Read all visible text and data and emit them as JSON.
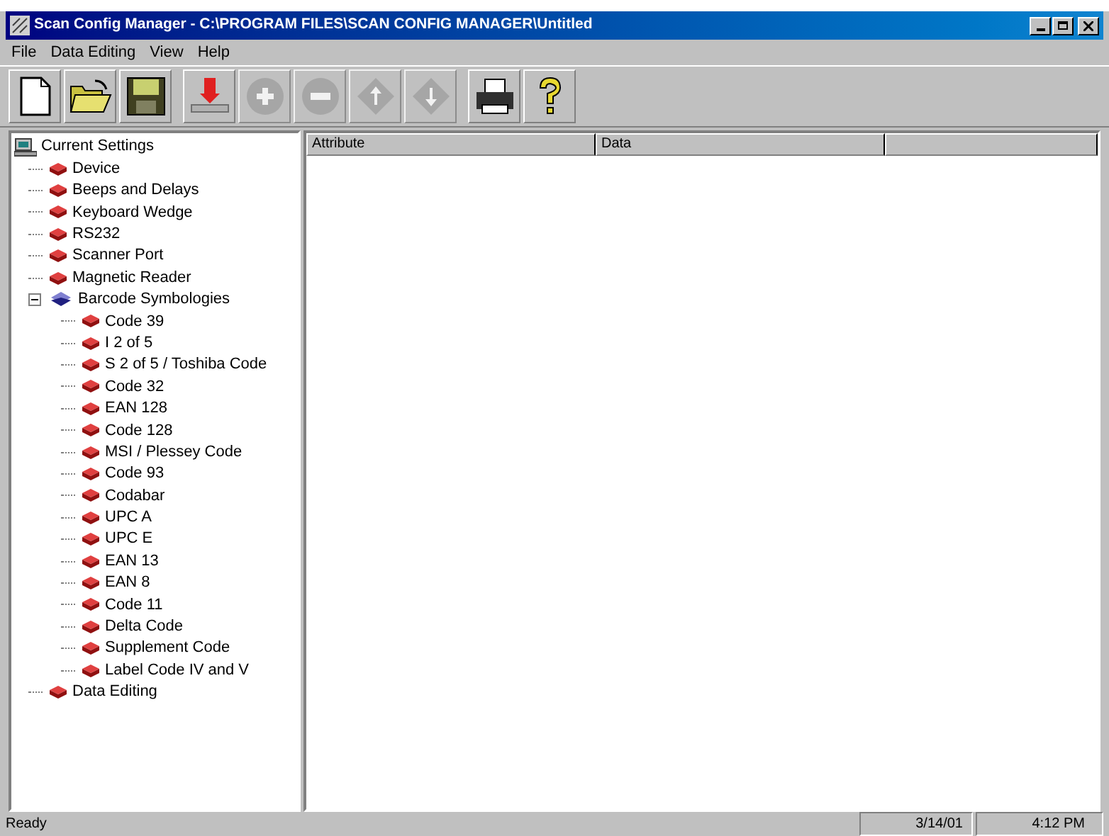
{
  "window": {
    "title": "Scan Config Manager - C:\\PROGRAM FILES\\SCAN CONFIG MANAGER\\Untitled"
  },
  "menu": [
    "File",
    "Data Editing",
    "View",
    "Help"
  ],
  "toolbar": [
    {
      "kind": "new",
      "disabled": false
    },
    {
      "kind": "open",
      "disabled": false
    },
    {
      "kind": "save",
      "disabled": false
    },
    {
      "kind": "download",
      "disabled": false
    },
    {
      "kind": "add",
      "disabled": true
    },
    {
      "kind": "remove",
      "disabled": true
    },
    {
      "kind": "up",
      "disabled": true
    },
    {
      "kind": "down",
      "disabled": true
    },
    {
      "kind": "print",
      "disabled": false
    },
    {
      "kind": "help",
      "disabled": false
    }
  ],
  "tree": {
    "label": "Current Settings",
    "children": [
      {
        "label": "Device"
      },
      {
        "label": "Beeps and Delays"
      },
      {
        "label": "Keyboard Wedge"
      },
      {
        "label": "RS232"
      },
      {
        "label": "Scanner Port"
      },
      {
        "label": "Magnetic Reader"
      },
      {
        "label": "Barcode Symbologies",
        "expanded": true,
        "children": [
          {
            "label": "Code 39"
          },
          {
            "label": "I 2 of 5"
          },
          {
            "label": "S 2 of 5 / Toshiba Code"
          },
          {
            "label": "Code 32"
          },
          {
            "label": "EAN 128"
          },
          {
            "label": "Code 128"
          },
          {
            "label": "MSI / Plessey Code"
          },
          {
            "label": "Code 93"
          },
          {
            "label": "Codabar"
          },
          {
            "label": "UPC A"
          },
          {
            "label": "UPC E"
          },
          {
            "label": "EAN 13"
          },
          {
            "label": "EAN 8"
          },
          {
            "label": "Code 11"
          },
          {
            "label": "Delta Code"
          },
          {
            "label": "Supplement Code"
          },
          {
            "label": "Label Code IV and V"
          }
        ]
      },
      {
        "label": "Data Editing"
      }
    ]
  },
  "table": {
    "columns": [
      "Attribute",
      "Data"
    ]
  },
  "status_bar": {
    "message": "Ready",
    "date": "3/14/01",
    "time": "4:12 PM"
  }
}
